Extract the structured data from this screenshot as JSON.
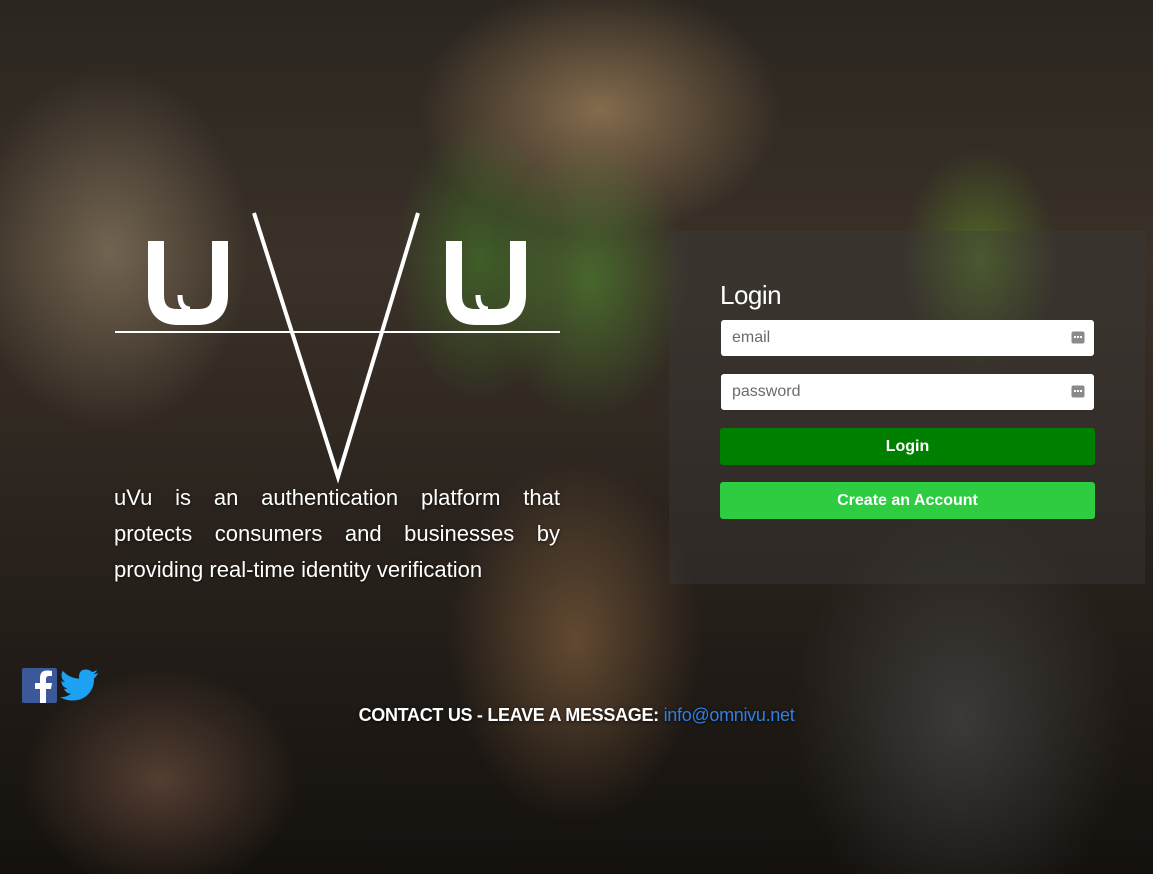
{
  "brand": {
    "logo_text": "uVu",
    "tagline": "uVu is an authentication platform that protects consumers and businesses by providing real-time identity verification"
  },
  "login": {
    "title": "Login",
    "email_placeholder": "email",
    "password_placeholder": "password",
    "login_button": "Login",
    "create_account_button": "Create an Account"
  },
  "social": {
    "items": [
      {
        "name": "facebook-icon",
        "color": "#3b5998"
      },
      {
        "name": "twitter-icon",
        "color": "#1da1f2"
      }
    ]
  },
  "contact": {
    "label": "CONTACT US - LEAVE A MESSAGE: ",
    "email": "info@omnivu.net"
  },
  "colors": {
    "login_button": "#008000",
    "create_account_button": "#2ecc40",
    "link": "#2f7fe6"
  }
}
